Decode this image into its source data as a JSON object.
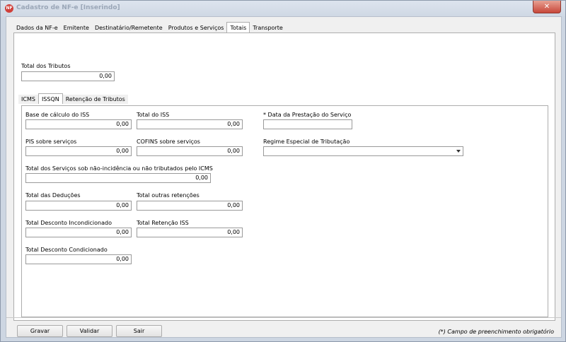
{
  "window": {
    "title": "Cadastro de NF-e [Inserindo]",
    "icon_text": "NF",
    "close_label": "✕"
  },
  "main_tabs": [
    {
      "label": "Dados da NF-e"
    },
    {
      "label": "Emitente"
    },
    {
      "label": "Destinatário/Remetente"
    },
    {
      "label": "Produtos e Serviços"
    },
    {
      "label": "Totais",
      "active": true
    },
    {
      "label": "Transporte"
    }
  ],
  "total_tributos": {
    "label": "Total dos Tributos",
    "value": "0,00"
  },
  "sub_tabs": [
    {
      "label": "ICMS"
    },
    {
      "label": "ISSQN",
      "active": true
    },
    {
      "label": "Retenção de Tributos"
    }
  ],
  "issqn": {
    "base_calculo": {
      "label": "Base de cálculo do ISS",
      "value": "0,00"
    },
    "total_iss": {
      "label": "Total do ISS",
      "value": "0,00"
    },
    "data_prestacao": {
      "label": "* Data da Prestação do Serviço",
      "value": ""
    },
    "pis": {
      "label": "PIS sobre serviços",
      "value": "0,00"
    },
    "cofins": {
      "label": "COFINS sobre serviços",
      "value": "0,00"
    },
    "regime": {
      "label": "Regime Especial de Tributação",
      "value": ""
    },
    "nao_incidencia": {
      "label": "Total dos Serviços sob não-incidência ou não tributados pelo ICMS",
      "value": "0,00"
    },
    "deducoes": {
      "label": "Total das Deduções",
      "value": "0,00"
    },
    "outras_retencoes": {
      "label": "Total outras retenções",
      "value": "0,00"
    },
    "desc_incondicionado": {
      "label": "Total Desconto Incondicionado",
      "value": "0,00"
    },
    "retencao_iss": {
      "label": "Total Retenção ISS",
      "value": "0,00"
    },
    "desc_condicionado": {
      "label": "Total Desconto Condicionado",
      "value": "0,00"
    }
  },
  "buttons": {
    "gravar": "Gravar",
    "validar": "Validar",
    "sair": "Sair"
  },
  "footer_note": "(*) Campo de preenchimento obrigatório"
}
